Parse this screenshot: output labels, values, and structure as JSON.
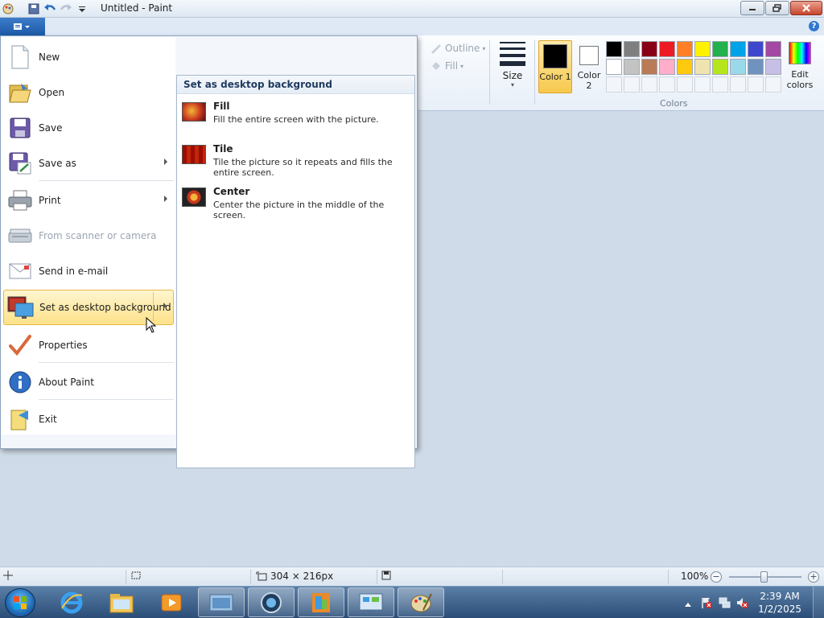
{
  "window": {
    "title": "Untitled - Paint"
  },
  "ribbon": {
    "outline_label": "Outline",
    "fill_label": "Fill",
    "size_label": "Size",
    "color1_label": "Color 1",
    "color2_label": "Color 2",
    "edit_colors_label": "Edit colors",
    "colors_group_label": "Colors",
    "palette": [
      "#000000",
      "#7f7f7f",
      "#880015",
      "#ed1c24",
      "#ff7f27",
      "#fff200",
      "#22b14c",
      "#00a2e8",
      "#3f48cc",
      "#a349a4",
      "#ffffff",
      "#c3c3c3",
      "#b97a57",
      "#ffaec9",
      "#ffc90e",
      "#efe4b0",
      "#b5e61d",
      "#99d9ea",
      "#7092be",
      "#c8bfe7"
    ],
    "palette_empty_slots": 10
  },
  "file_menu": {
    "items": [
      {
        "id": "new",
        "label": "New",
        "icon": "new-file-icon",
        "has_submenu": false
      },
      {
        "id": "open",
        "label": "Open",
        "icon": "folder-open-icon",
        "has_submenu": false
      },
      {
        "id": "save",
        "label": "Save",
        "icon": "floppy-disk-icon",
        "has_submenu": false
      },
      {
        "id": "save-as",
        "label": "Save as",
        "icon": "save-as-icon",
        "has_submenu": true
      },
      {
        "id": "print",
        "label": "Print",
        "icon": "printer-icon",
        "has_submenu": true
      },
      {
        "id": "scanner",
        "label": "From scanner or camera",
        "icon": "scanner-icon",
        "has_submenu": false,
        "disabled": true
      },
      {
        "id": "email",
        "label": "Send in e-mail",
        "icon": "envelope-icon",
        "has_submenu": false
      },
      {
        "id": "desktop-bg",
        "label": "Set as desktop background",
        "icon": "desktop-background-icon",
        "has_submenu": true,
        "highlighted": true
      },
      {
        "id": "properties",
        "label": "Properties",
        "icon": "checkmark-icon",
        "has_submenu": false
      },
      {
        "id": "about",
        "label": "About Paint",
        "icon": "info-icon",
        "has_submenu": false
      },
      {
        "id": "exit",
        "label": "Exit",
        "icon": "exit-icon",
        "has_submenu": false
      }
    ]
  },
  "submenu": {
    "header": "Set as desktop background",
    "items": [
      {
        "title": "Fill",
        "desc": "Fill the entire screen with the picture."
      },
      {
        "title": "Tile",
        "desc": "Tile the picture so it repeats and fills the entire screen."
      },
      {
        "title": "Center",
        "desc": "Center the picture in the middle of the screen."
      }
    ]
  },
  "statusbar": {
    "dimensions": "304 × 216px",
    "zoom": "100%"
  },
  "taskbar": {
    "time": "2:39 AM",
    "date": "1/2/2025"
  }
}
